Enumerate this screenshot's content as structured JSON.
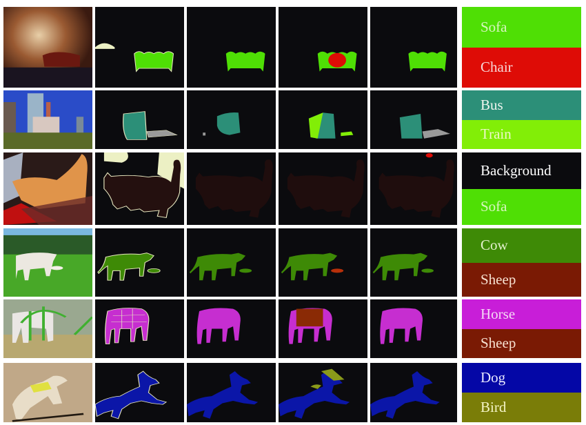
{
  "figure": {
    "description": "Semantic segmentation comparison grid: input image, ground truth, three method outputs, and class legend",
    "rows": [
      {
        "scene": "living room with sofa",
        "legend": [
          {
            "label": "Sofa",
            "color": "#4fdf05",
            "text_color": "#d9f5c0"
          },
          {
            "label": "Chair",
            "color": "#de0c06",
            "text_color": "#f7d8d8"
          }
        ]
      },
      {
        "scene": "city street with bus",
        "legend": [
          {
            "label": "Bus",
            "color": "#2c8f78",
            "text_color": "#f0f6f0"
          },
          {
            "label": "Train",
            "color": "#82ee07",
            "text_color": "#eef8c8"
          }
        ]
      },
      {
        "scene": "cat on rug",
        "legend": [
          {
            "label": "Background",
            "color": "#0b0b0e",
            "text_color": "#ffffff"
          },
          {
            "label": "Sofa",
            "color": "#4fdf05",
            "text_color": "#d9f5c0"
          }
        ]
      },
      {
        "scene": "cow and calf in field",
        "legend": [
          {
            "label": "Cow",
            "color": "#3e8a06",
            "text_color": "#e2f0cc"
          },
          {
            "label": "Sheep",
            "color": "#7a1a04",
            "text_color": "#f7e2d2"
          }
        ]
      },
      {
        "scene": "horse behind playground",
        "legend": [
          {
            "label": "Horse",
            "color": "#c81ed8",
            "text_color": "#f5d8f5"
          },
          {
            "label": "Sheep",
            "color": "#7a1a04",
            "text_color": "#f7e2d2"
          }
        ]
      },
      {
        "scene": "running dog",
        "legend": [
          {
            "label": "Dog",
            "color": "#0407a6",
            "text_color": "#e8e8ff"
          },
          {
            "label": "Bird",
            "color": "#7a7d08",
            "text_color": "#f6f6c8"
          }
        ]
      }
    ],
    "mask_colors": {
      "background": "#0b0b0e",
      "boundary": "#e8e8c0",
      "void": "#ecf0c4",
      "sofa": "#4fdf05",
      "chair": "#de0c06",
      "bus": "#2c8f78",
      "train": "#82ee07",
      "gray": "#9a9a9a",
      "cat": "#24100f",
      "cat_pred": "#1f0d0d",
      "cow": "#3e8a06",
      "sheep": "#b8300a",
      "horse": "#c62ed0",
      "sheep_dark": "#8a2a05",
      "dog": "#0b16a8",
      "bird": "#8a9a1a"
    }
  }
}
